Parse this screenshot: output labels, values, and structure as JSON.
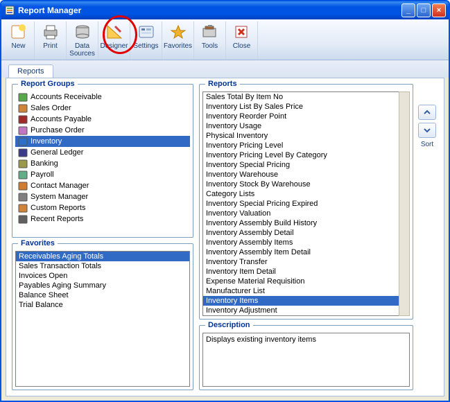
{
  "window": {
    "title": "Report Manager"
  },
  "toolbar": {
    "new": "New",
    "print": "Print",
    "datasources": "Data Sources",
    "designer": "Designer",
    "settings": "Settings",
    "favorites": "Favorites",
    "tools": "Tools",
    "close": "Close"
  },
  "tabs": {
    "reports": "Reports"
  },
  "groups": {
    "legend": "Report Groups",
    "items": [
      {
        "label": "Accounts Receivable"
      },
      {
        "label": "Sales Order"
      },
      {
        "label": "Accounts Payable"
      },
      {
        "label": "Purchase Order"
      },
      {
        "label": "Inventory",
        "selected": true
      },
      {
        "label": "General Ledger"
      },
      {
        "label": "Banking"
      },
      {
        "label": "Payroll"
      },
      {
        "label": "Contact Manager"
      },
      {
        "label": "System Manager"
      },
      {
        "label": "Custom Reports"
      },
      {
        "label": "Recent Reports"
      }
    ]
  },
  "favorites": {
    "legend": "Favorites",
    "items": [
      {
        "label": "Receivables Aging Totals",
        "selected": true
      },
      {
        "label": "Sales Transaction Totals"
      },
      {
        "label": "Invoices Open"
      },
      {
        "label": "Payables Aging Summary"
      },
      {
        "label": "Balance Sheet"
      },
      {
        "label": "Trial Balance"
      }
    ]
  },
  "reports": {
    "legend": "Reports",
    "items": [
      {
        "label": "Sales Total By Item No"
      },
      {
        "label": "Inventory List By Sales Price"
      },
      {
        "label": "Inventory Reorder Point"
      },
      {
        "label": "Inventory Usage"
      },
      {
        "label": "Physical Inventory"
      },
      {
        "label": "Inventory Pricing Level"
      },
      {
        "label": "Inventory Pricing Level By Category"
      },
      {
        "label": "Inventory Special Pricing"
      },
      {
        "label": "Inventory Warehouse"
      },
      {
        "label": "Inventory Stock By Warehouse"
      },
      {
        "label": "Category Lists"
      },
      {
        "label": "Inventory Special Pricing Expired"
      },
      {
        "label": "Inventory Valuation"
      },
      {
        "label": "Inventory Assembly Build History"
      },
      {
        "label": "Inventory Assembly Detail"
      },
      {
        "label": "Inventory Assembly Items"
      },
      {
        "label": "Inventory Assembly Item Detail"
      },
      {
        "label": "Inventory Transfer"
      },
      {
        "label": "Inventory Item Detail"
      },
      {
        "label": "Expense Material Requisition"
      },
      {
        "label": "Manufacturer List"
      },
      {
        "label": "Inventory Items",
        "selected": true
      },
      {
        "label": "Inventory Adjustment"
      }
    ]
  },
  "description": {
    "legend": "Description",
    "text": "Displays existing inventory items"
  },
  "sort": {
    "label": "Sort"
  }
}
